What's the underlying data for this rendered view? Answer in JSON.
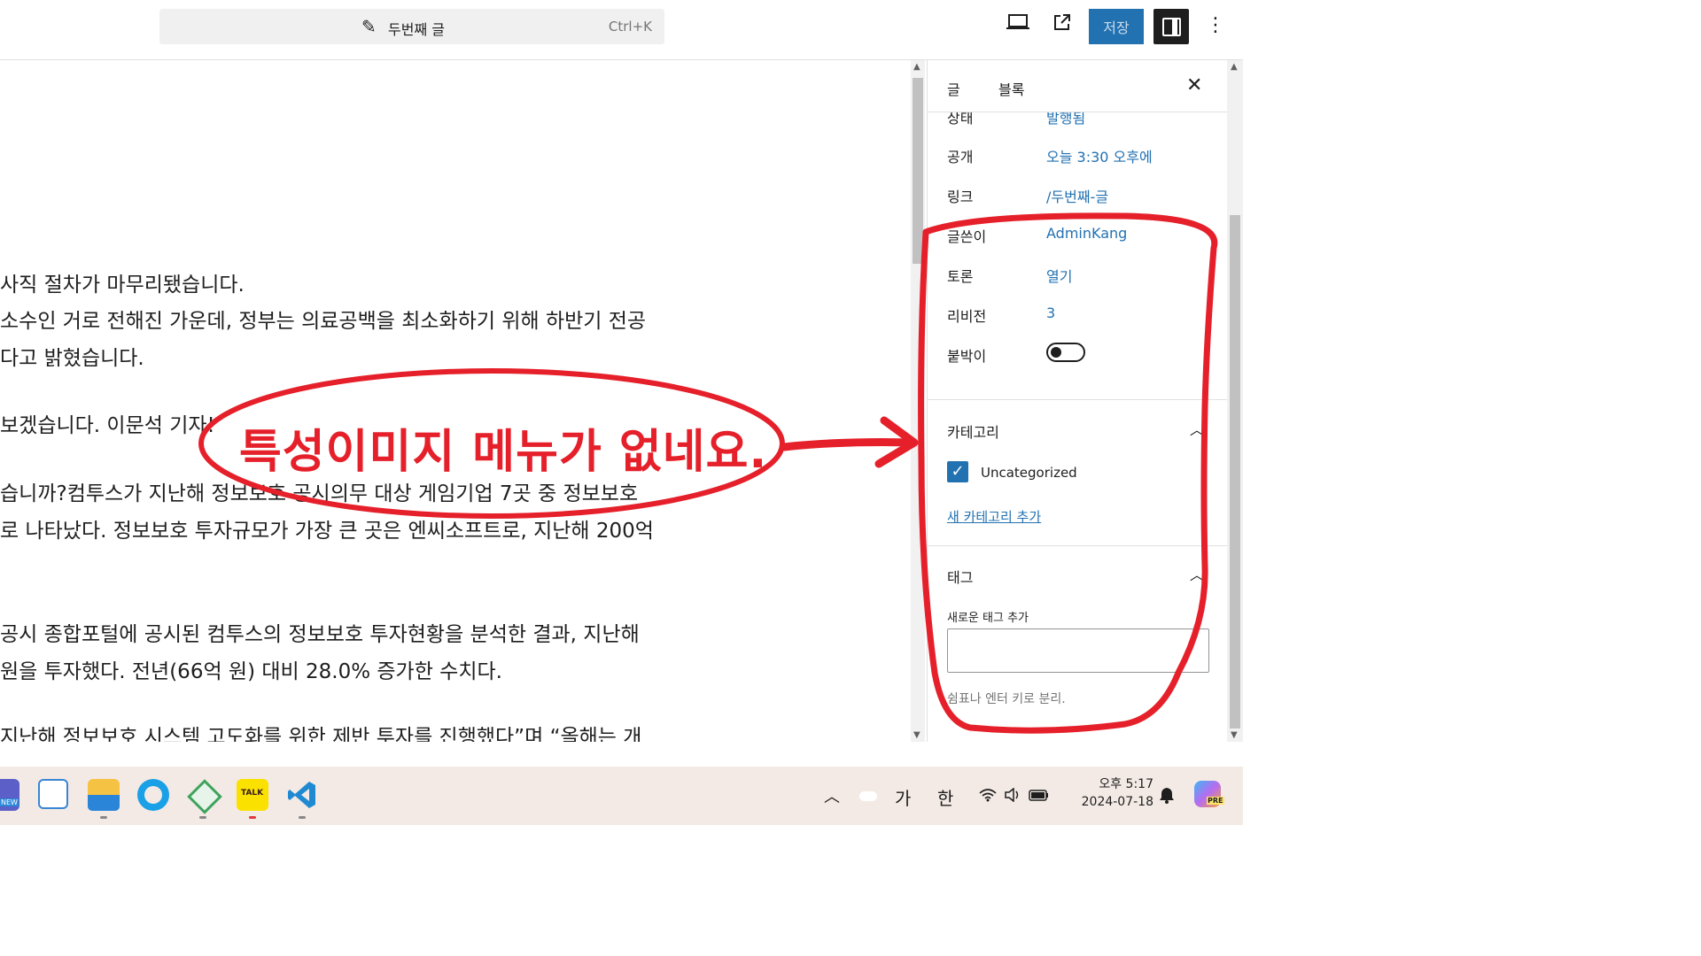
{
  "topbar": {
    "doc_title": "두번째 글",
    "shortcut": "Ctrl+K",
    "save_label": "저장",
    "icons": [
      "pen-icon",
      "desktop-preview-icon",
      "external-link-icon",
      "sidebar-toggle-icon",
      "more-options-icon"
    ]
  },
  "editor": {
    "lines": [
      "사직 절차가 마무리됐습니다.",
      "소수인 거로 전해진 가운데, 정부는 의료공백을 최소화하기 위해 하반기 전공",
      "다고 밝혔습니다.",
      "보겠습니다. 이문석 기자!",
      "습니까?컴투스가 지난해 정보보호 공시의무 대상 게임기업 7곳 중 정보보호",
      "로 나타났다. 정보보호 투자규모가 가장 큰 곳은 엔씨소프트로, 지난해 200억",
      "공시 종합포털에 공시된 컴투스의 정보보호 투자현황을 분석한 결과, 지난해",
      "원을 투자했다. 전년(66억 원) 대비 28.0% 증가한 수치다.",
      "지난해 정보보호 시스템 고도화를 위한 제반 투자를 진행했다”며 “올해는 개"
    ]
  },
  "sidebar": {
    "tabs": [
      "글",
      "블록"
    ],
    "rows": [
      {
        "label": "상태",
        "value": "발행됨"
      },
      {
        "label": "공개",
        "value": "오늘 3:30 오후에"
      },
      {
        "label": "링크",
        "value": "/두번째-글"
      },
      {
        "label": "글쓴이",
        "value": "AdminKang"
      },
      {
        "label": "토론",
        "value": "열기"
      },
      {
        "label": "리비전",
        "value": "3"
      }
    ],
    "sticky_label": "붙박이",
    "sticky_on": false,
    "categories": {
      "title": "카테고리",
      "items": [
        {
          "label": "Uncategorized",
          "checked": true
        }
      ],
      "add_link": "새 카테고리 추가"
    },
    "tags": {
      "title": "태그",
      "input_label": "새로운 태그 추가",
      "help": "쉼표나 엔터 키로 분리."
    }
  },
  "taskbar": {
    "apps": [
      "teams-icon",
      "whiteboard-icon",
      "file-explorer-icon",
      "edge-icon",
      "git-icon",
      "kakaotalk-icon",
      "vscode-icon"
    ],
    "kakaotalk_badge": "TALK",
    "new_badge": "NEW",
    "tray": {
      "ime_1": "가",
      "ime_2": "한",
      "time": "오후 5:17",
      "date": "2024-07-18",
      "copilot_badge": "PRE"
    }
  },
  "annotation": {
    "text": "특성이미지 메뉴가 없네요.",
    "color": "#e5202a"
  }
}
